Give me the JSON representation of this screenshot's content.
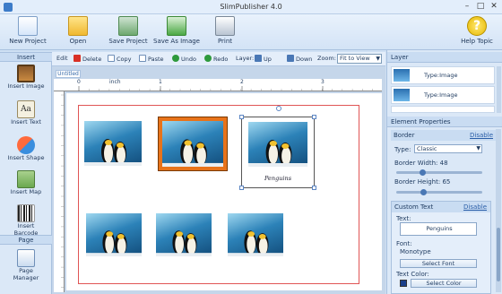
{
  "app": {
    "title": "SlimPublisher 4.0"
  },
  "ribbon": {
    "buttons": [
      {
        "label": "New Project",
        "icon": "new-project-icon"
      },
      {
        "label": "Open",
        "icon": "folder-icon"
      },
      {
        "label": "Save Project",
        "icon": "save-project-icon"
      },
      {
        "label": "Save As Image",
        "icon": "save-image-icon"
      },
      {
        "label": "Print",
        "icon": "printer-icon"
      }
    ],
    "help": "Help Topic"
  },
  "left": {
    "insert_header": "Insert",
    "tools": [
      {
        "label": "Insert Image",
        "icon": "image-icon"
      },
      {
        "label": "Insert Text",
        "icon": "text-icon"
      },
      {
        "label": "Insert Shape",
        "icon": "shape-icon"
      },
      {
        "label": "Insert Map",
        "icon": "map-icon"
      },
      {
        "label": "Insert Barcode",
        "icon": "barcode-icon"
      }
    ],
    "page_header": "Page",
    "page_manager": "Page Manager"
  },
  "toolbar": {
    "edit": "Edit",
    "delete": "Delete",
    "copy": "Copy",
    "paste": "Paste",
    "undo": "Undo",
    "redo": "Redo",
    "layer": "Layer:",
    "up": "Up",
    "down": "Down",
    "zoom": "Zoom:",
    "zoom_value": "Fit to View"
  },
  "canvas": {
    "tab": "Untitled",
    "ruler_unit": "inch",
    "ruler_numbers": [
      "0",
      "1",
      "2",
      "3"
    ],
    "caption": "Penguins"
  },
  "right": {
    "layer_header": "Layer",
    "layers": [
      "Type:Image",
      "Type:Image"
    ],
    "props_header": "Element Properties",
    "border": {
      "title": "Border",
      "disable": "Disable",
      "type_label": "Type:",
      "type_value": "Classic",
      "width_label": "Border Width:",
      "width_value": "48",
      "height_label": "Border Height:",
      "height_value": "65"
    },
    "custom_text": {
      "title": "Custom Text",
      "disable": "Disable",
      "text_label": "Text:",
      "text_value": "Penguins",
      "font_label": "Font:",
      "font_value": "Monotype",
      "select_font": "Select Font",
      "color_label": "Text Color:",
      "select_color": "Select Color"
    }
  },
  "colors": {
    "accent": "#3d7cc9",
    "frame_orange": "#e8731a",
    "page_border": "#e05555"
  }
}
